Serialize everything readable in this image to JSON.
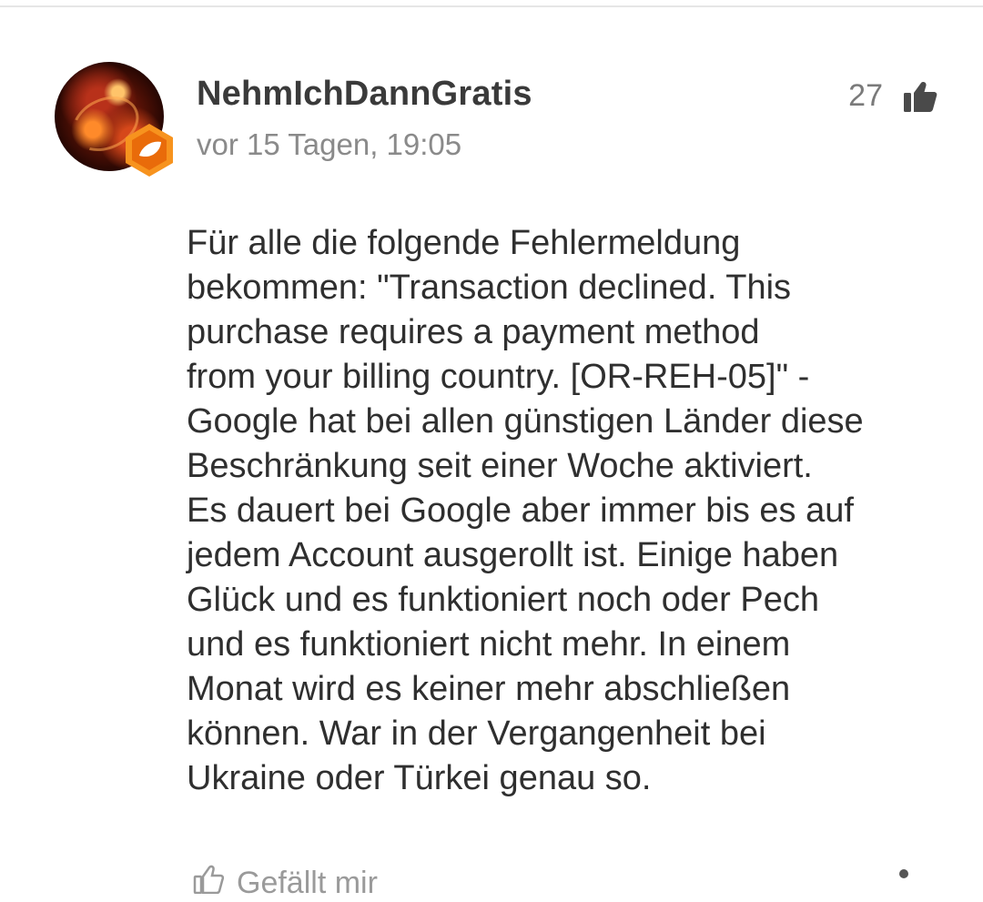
{
  "comment": {
    "username": "NehmIchDannGratis",
    "timestamp": "vor 15 Tagen, 19:05",
    "likes": "27",
    "body_lines": [
      "Für alle die folgende Fehlermeldung",
      "bekommen: \"Transaction declined. This",
      "purchase requires a payment method",
      "from your billing country. [OR-REH-05]\" -",
      "Google hat bei allen günstigen Länder diese",
      "Beschränkung seit einer Woche aktiviert.",
      "Es dauert bei Google aber immer bis es auf",
      "jedem Account ausgerollt ist. Einige haben",
      "Glück und es funktioniert noch oder Pech",
      "und es funktioniert nicht mehr. In einem",
      "Monat wird es keiner mehr abschließen",
      "können. War in der Vergangenheit bei",
      "Ukraine oder Türkei genau so."
    ],
    "footer_label": "Gefällt mir"
  },
  "icons": {
    "like": "thumbs-up-icon",
    "badge": "hexagon-badge-icon",
    "footer_like": "thumbs-up-outline-icon",
    "more": "more-options-icon"
  },
  "colors": {
    "badge": "#f7931e",
    "username": "#3a3a3a",
    "meta": "#8a8a8a",
    "text": "#2f2f2f"
  }
}
